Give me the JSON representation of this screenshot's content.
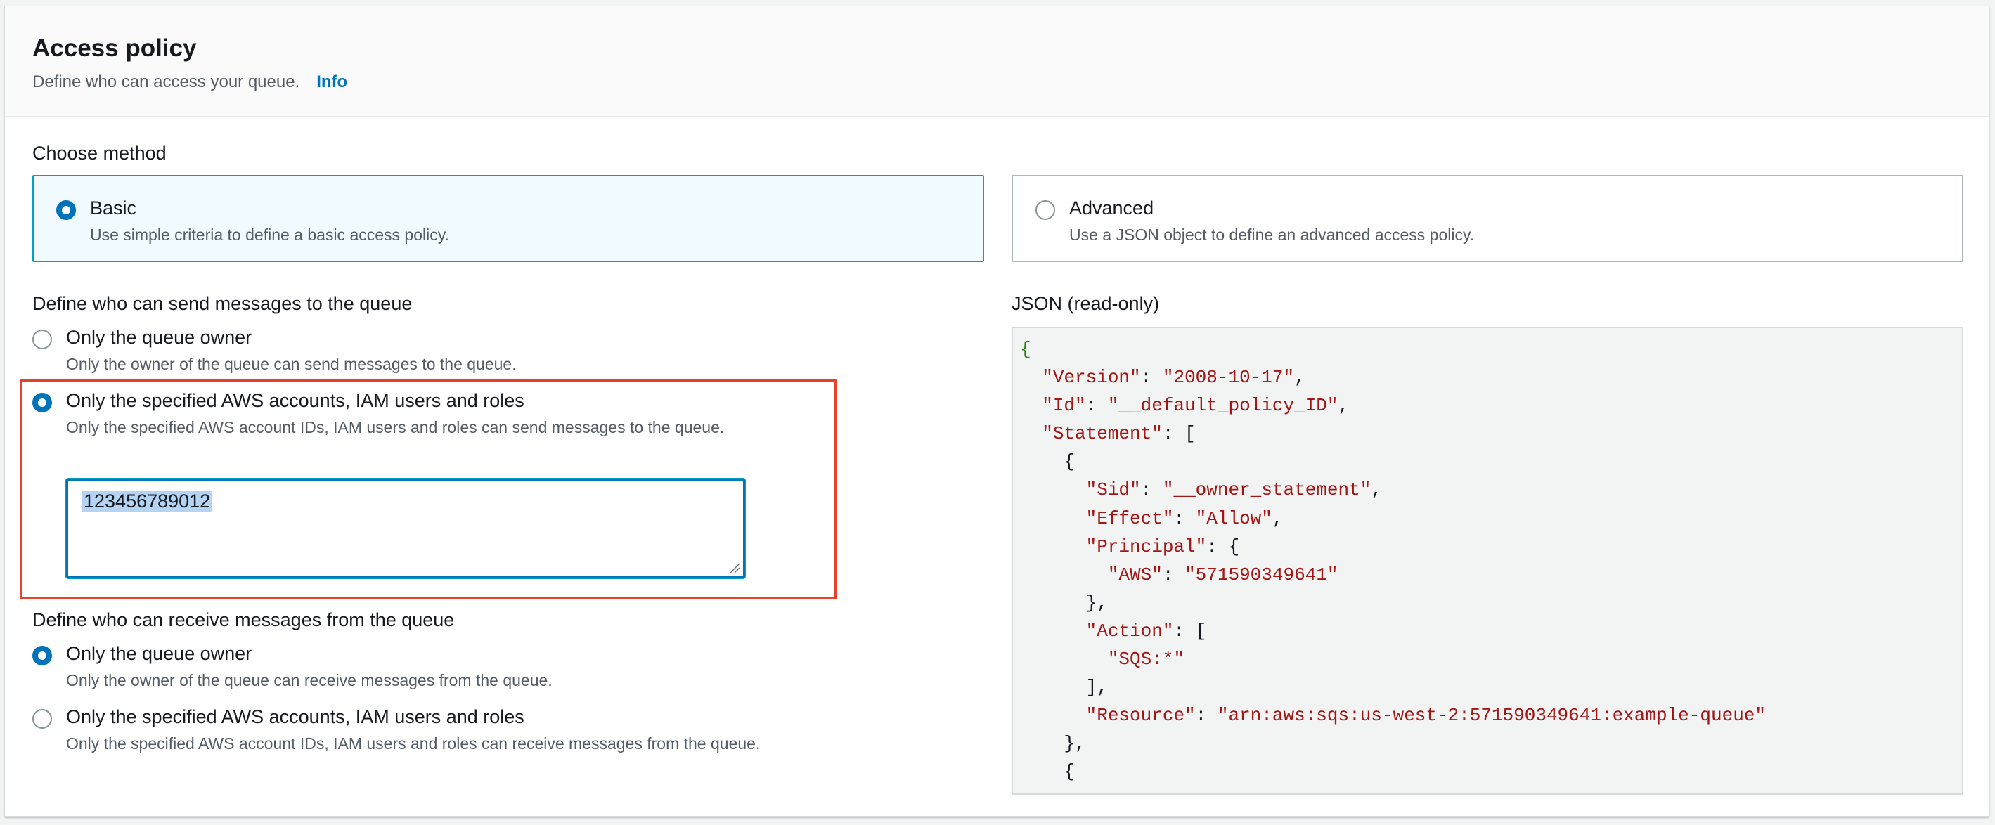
{
  "header": {
    "title": "Access policy",
    "description": "Define who can access your queue.",
    "info_link": "Info"
  },
  "method": {
    "label": "Choose method",
    "options": [
      {
        "title": "Basic",
        "description": "Use simple criteria to define a basic access policy.",
        "selected": true
      },
      {
        "title": "Advanced",
        "description": "Use a JSON object to define an advanced access policy.",
        "selected": false
      }
    ]
  },
  "send": {
    "label": "Define who can send messages to the queue",
    "options": [
      {
        "title": "Only the queue owner",
        "description": "Only the owner of the queue can send messages to the queue.",
        "selected": false
      },
      {
        "title": "Only the specified AWS accounts, IAM users and roles",
        "description": "Only the specified AWS account IDs, IAM users and roles can send messages to the queue.",
        "selected": true
      }
    ],
    "accounts_value": "123456789012"
  },
  "receive": {
    "label": "Define who can receive messages from the queue",
    "options": [
      {
        "title": "Only the queue owner",
        "description": "Only the owner of the queue can receive messages from the queue.",
        "selected": true
      },
      {
        "title": "Only the specified AWS accounts, IAM users and roles",
        "description": "Only the specified AWS account IDs, IAM users and roles can receive messages from the queue.",
        "selected": false
      }
    ]
  },
  "json": {
    "label": "JSON (read-only)",
    "lines": [
      {
        "indent": "",
        "key": "",
        "val": "",
        "tail": "{",
        "green": true
      },
      {
        "indent": "  ",
        "key": "\"Version\"",
        "val": "\"2008-10-17\"",
        "tail": ","
      },
      {
        "indent": "  ",
        "key": "\"Id\"",
        "val": "\"__default_policy_ID\"",
        "tail": ","
      },
      {
        "indent": "  ",
        "key": "\"Statement\"",
        "val": "",
        "tail": ": ["
      },
      {
        "indent": "    ",
        "key": "",
        "val": "",
        "tail": "{"
      },
      {
        "indent": "      ",
        "key": "\"Sid\"",
        "val": "\"__owner_statement\"",
        "tail": ","
      },
      {
        "indent": "      ",
        "key": "\"Effect\"",
        "val": "\"Allow\"",
        "tail": ","
      },
      {
        "indent": "      ",
        "key": "\"Principal\"",
        "val": "",
        "tail": ": {"
      },
      {
        "indent": "        ",
        "key": "\"AWS\"",
        "val": "\"571590349641\"",
        "tail": ""
      },
      {
        "indent": "      ",
        "key": "",
        "val": "",
        "tail": "},"
      },
      {
        "indent": "      ",
        "key": "\"Action\"",
        "val": "",
        "tail": ": ["
      },
      {
        "indent": "        ",
        "key": "",
        "val": "\"SQS:*\"",
        "tail": ""
      },
      {
        "indent": "      ",
        "key": "",
        "val": "",
        "tail": "],"
      },
      {
        "indent": "      ",
        "key": "\"Resource\"",
        "val": "\"arn:aws:sqs:us-west-2:571590349641:example-queue\"",
        "tail": ""
      },
      {
        "indent": "    ",
        "key": "",
        "val": "",
        "tail": "},"
      },
      {
        "indent": "    ",
        "key": "",
        "val": "",
        "tail": "{"
      }
    ]
  }
}
